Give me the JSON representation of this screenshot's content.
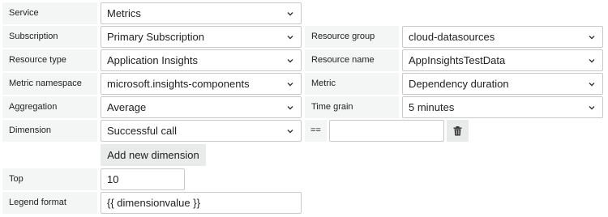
{
  "rows": {
    "service": {
      "label": "Service",
      "value": "Metrics"
    },
    "subscription": {
      "label": "Subscription",
      "value": "Primary Subscription"
    },
    "resource_group": {
      "label": "Resource group",
      "value": "cloud-datasources"
    },
    "resource_type": {
      "label": "Resource type",
      "value": "Application Insights"
    },
    "resource_name": {
      "label": "Resource name",
      "value": "AppInsightsTestData"
    },
    "metric_namespace": {
      "label": "Metric namespace",
      "value": "microsoft.insights-components"
    },
    "metric": {
      "label": "Metric",
      "value": "Dependency duration"
    },
    "aggregation": {
      "label": "Aggregation",
      "value": "Average"
    },
    "time_grain": {
      "label": "Time grain",
      "value": "5 minutes"
    },
    "dimension": {
      "label": "Dimension",
      "value": "Successful call",
      "operator": "==",
      "filter_value": ""
    },
    "add_dimension": {
      "label": "Add new dimension"
    },
    "top": {
      "label": "Top",
      "value": "10"
    },
    "legend_format": {
      "label": "Legend format",
      "value": "{{ dimensionvalue }}"
    }
  },
  "icons": {
    "dropdown": "chevron-down-icon",
    "remove": "trash-icon"
  }
}
